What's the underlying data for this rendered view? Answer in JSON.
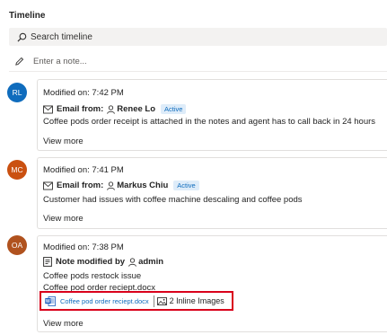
{
  "header": {
    "title": "Timeline"
  },
  "search": {
    "label": "Search timeline",
    "icon": "search-icon"
  },
  "note": {
    "placeholder": "Enter a note...",
    "icon": "pencil-icon"
  },
  "items": [
    {
      "initials": "RL",
      "avatar_color": "#0f6cbd",
      "modified": "Modified on: 7:42 PM",
      "type_label": "Email from:",
      "person": "Renee Lo",
      "status": "Active",
      "body": "Coffee pods order receipt is attached in the notes and agent has to call back in 24 hours",
      "view_more": "View more"
    },
    {
      "initials": "MC",
      "avatar_color": "#ca5010",
      "modified": "Modified on: 7:41 PM",
      "type_label": "Email from:",
      "person": "Markus Chiu",
      "status": "Active",
      "body": "Customer had issues with coffee machine descaling and coffee pods",
      "view_more": "View more"
    },
    {
      "initials": "OA",
      "avatar_color": "#b0521e",
      "modified": "Modified on: 7:38 PM",
      "type_label": "Note modified by",
      "person": "admin",
      "body_line1": "Coffee pods restock issue",
      "body_line2": "Coffee pod order reciept.docx",
      "attachment_file": "Coffee pod order reciept.docx",
      "attachment_images": "2 Inline Images",
      "view_more": "View more"
    }
  ],
  "colors": {
    "accent": "#0f6cbd",
    "highlight_border": "#d9001b"
  }
}
